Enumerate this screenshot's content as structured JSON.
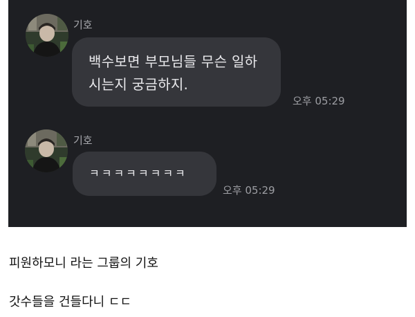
{
  "chat": {
    "messages": [
      {
        "sender": "기호",
        "lines": [
          "백수보면 부모님들 무슨 일하",
          "시는지 궁금하지."
        ],
        "time": "오후 05:29"
      },
      {
        "sender": "기호",
        "text": "ㅋㅋㅋㅋㅋㅋㅋㅋ",
        "time": "오후 05:29"
      }
    ]
  },
  "captions": [
    "피원하모니 라는 그룹의 기호",
    "갓수들을 건들다니 ㄷㄷ"
  ],
  "colors": {
    "chat_background": "#1e1f23",
    "bubble": "#35363b",
    "bubble_text": "#e9e9ec",
    "meta_text": "#9d9ea3",
    "page_background": "#ffffff",
    "caption_text": "#111111"
  },
  "icons": {
    "avatar": "profile-photo"
  }
}
